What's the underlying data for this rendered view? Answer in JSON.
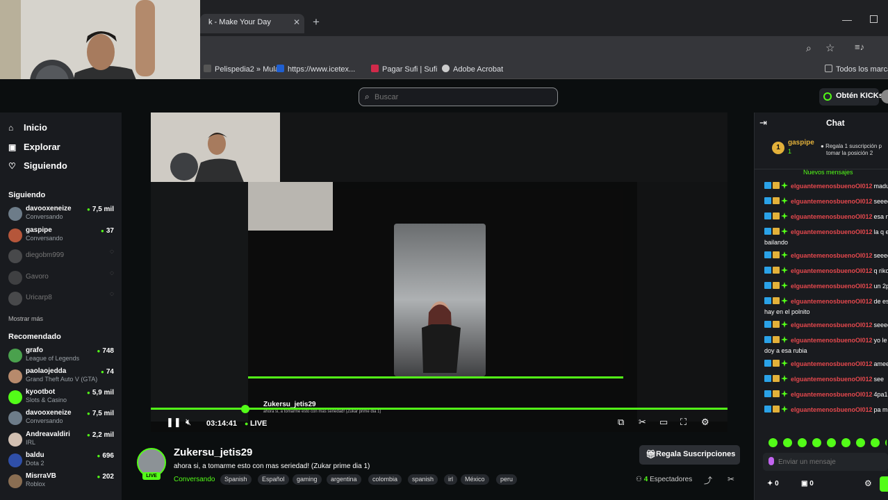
{
  "browser": {
    "tab_title": "k - Make Your Day",
    "bookmarks": [
      {
        "label": "Pelispedia2 » Mulán",
        "color": "#555"
      },
      {
        "label": "https://www.icetex...",
        "color": "#1f5fd1"
      },
      {
        "label": "Pagar Sufi | Sufi",
        "color": "#d12a4a"
      },
      {
        "label": "Adobe Acrobat",
        "color": "#cccccc"
      },
      {
        "label": "Todos los marca",
        "color": "#bbbbbb"
      }
    ]
  },
  "topbar": {
    "search_placeholder": "Buscar",
    "kicks_label": "Obtén KICKs"
  },
  "sidebar": {
    "nav": [
      {
        "label": "Inicio",
        "icon": "home-icon"
      },
      {
        "label": "Explorar",
        "icon": "compass-icon"
      },
      {
        "label": "Siguiendo",
        "icon": "heart-icon"
      }
    ],
    "following_title": "Siguiendo",
    "following": [
      {
        "name": "davooxeneize",
        "sub": "Conversando",
        "viewers": "7,5 mil",
        "color": "#6d7c89",
        "online": true
      },
      {
        "name": "gaspipe",
        "sub": "Conversando",
        "viewers": "37",
        "color": "#b5563a",
        "online": true
      },
      {
        "name": "diegobm999",
        "sub": "",
        "viewers": "",
        "color": "#777",
        "online": false
      },
      {
        "name": "Gavoro",
        "sub": "",
        "viewers": "",
        "color": "#666",
        "online": false
      },
      {
        "name": "Uricarp8",
        "sub": "",
        "viewers": "",
        "color": "#777",
        "online": false
      }
    ],
    "show_more": "Mostrar más",
    "recommended_title": "Recomendado",
    "recommended": [
      {
        "name": "grafo",
        "sub": "League of Legends",
        "viewers": "748",
        "color": "#4aa14d"
      },
      {
        "name": "paolaojedda",
        "sub": "Grand Theft Auto V (GTA)",
        "viewers": "74",
        "color": "#b78a6c"
      },
      {
        "name": "kyootbot",
        "sub": "Slots & Casino",
        "viewers": "5,9 mil",
        "color": "#53fc18"
      },
      {
        "name": "davooxeneize",
        "sub": "Conversando",
        "viewers": "7,5 mil",
        "color": "#6d7c89"
      },
      {
        "name": "Andreavaldiri",
        "sub": "IRL",
        "viewers": "2,2 mil",
        "color": "#d2c0b2"
      },
      {
        "name": "baldu",
        "sub": "Dota 2",
        "viewers": "696",
        "color": "#2f4fa8"
      },
      {
        "name": "MisrraVB",
        "sub": "Roblox",
        "viewers": "202",
        "color": "#8a6e52"
      }
    ]
  },
  "player": {
    "time": "03:14:41",
    "live": "LIVE",
    "nested_title": "Zukersu_jetis29",
    "nested_sub": "ahora si, a tomarme esto con mas seriedad! (Zukar prime dia 1)"
  },
  "channel": {
    "name": "Zukersu_jetis29",
    "live_badge": "LIVE",
    "title": "ahora si, a tomarme esto con mas seriedad! (Zukar prime dia 1)",
    "category": "Conversando",
    "tags": [
      "Spanish",
      "Español",
      "gaming",
      "argentina",
      "colombia",
      "spanish",
      "irl",
      "México",
      "peru"
    ],
    "sub_button": "Regala Suscripciones",
    "viewers_count": "4",
    "viewers_label": "Espectadores"
  },
  "chat": {
    "title": "Chat",
    "pinned": {
      "badge": "1",
      "user": "gaspipe",
      "count": "1",
      "text_1": "Regala 1 suscripción p",
      "text_2": "tomar la posición 2"
    },
    "new_messages": "Nuevos mensajes",
    "username": "elguantemenosbuenoOI012",
    "messages": [
      {
        "text": "maduu",
        "cont": ""
      },
      {
        "text": "seeee",
        "cont": ""
      },
      {
        "text": "esa no",
        "cont": ""
      },
      {
        "text": "la q es",
        "cont": "bailando"
      },
      {
        "text": "seeee",
        "cont": ""
      },
      {
        "text": "q riko",
        "cont": ""
      },
      {
        "text": "un 2p",
        "cont": ""
      },
      {
        "text": "de esa",
        "cont": "hay en el polnito"
      },
      {
        "text": "seeee",
        "cont": ""
      },
      {
        "text": "yo le s",
        "cont": "doy a esa rubia"
      },
      {
        "text": "ameen",
        "cont": ""
      },
      {
        "text": "see",
        "cont": ""
      },
      {
        "text": "4pa1",
        "cont": ""
      },
      {
        "text": "pa mi",
        "cont": ""
      }
    ],
    "input_placeholder": "Enviar un mensaje",
    "kicks_balance": "0",
    "subs_balance": "0"
  }
}
